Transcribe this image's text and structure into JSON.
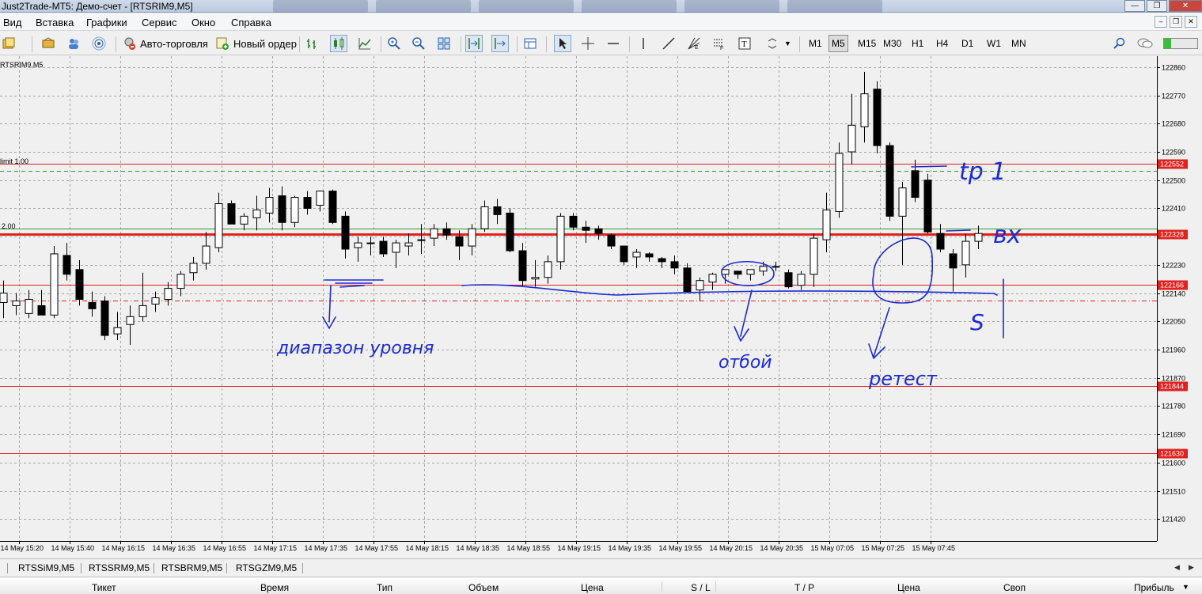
{
  "window": {
    "title": "Just2Trade-MT5: Демо-счет - [RTSRIM9,M5]"
  },
  "menu": [
    "Вид",
    "Вставка",
    "Графики",
    "Сервис",
    "Окно",
    "Справка"
  ],
  "toolbar": {
    "algo_trading_label": "Авто-торговля",
    "new_order_label": "Новый ордер",
    "timeframes": [
      "M1",
      "M5",
      "M15",
      "M30",
      "H1",
      "H4",
      "D1",
      "W1",
      "MN"
    ],
    "active_timeframe": "M5"
  },
  "chart": {
    "symbol_label": "RTSRIM9,M5",
    "limit_label": "limit 1.00",
    "position_label": "2.00",
    "up_color": "#ffffff",
    "down_color": "#000000",
    "grid_color": "#a8a8a8",
    "level_color": "#e0211e",
    "annotation_color": "#1c2bd6",
    "handwriting": {
      "tp": "tp 1",
      "entry": "вх",
      "stop": "S",
      "range": "диапазон уровня",
      "bounce": "отбой",
      "retest": "ретест"
    }
  },
  "chart_data": {
    "type": "candlestick",
    "symbol": "RTSRIM9",
    "timeframe": "M5",
    "y_ticks": [
      122860,
      122770,
      122680,
      122590,
      122500,
      122410,
      122320,
      122230,
      122140,
      122050,
      121960,
      121870,
      121780,
      121690,
      121600,
      121510,
      121420
    ],
    "ylim": [
      121350,
      122895
    ],
    "x_ticks": [
      "14 May 15:20",
      "14 May 15:40",
      "14 May 16:15",
      "14 May 16:35",
      "14 May 16:55",
      "14 May 17:15",
      "14 May 17:35",
      "14 May 17:55",
      "14 May 18:15",
      "14 May 18:35",
      "14 May 18:55",
      "14 May 19:15",
      "14 May 19:35",
      "14 May 19:55",
      "14 May 20:15",
      "14 May 20:35",
      "15 May 07:05",
      "15 May 07:25",
      "15 May 07:45"
    ],
    "price_levels": [
      {
        "label": "122552",
        "price": 122552,
        "style": "solid",
        "color": "#e0211e"
      },
      {
        "label": "122328",
        "price": 122328,
        "style": "solid-thick",
        "color": "#e0211e"
      },
      {
        "label": "122166",
        "price": 122166,
        "style": "solid",
        "color": "#e0211e"
      },
      {
        "label": "121844",
        "price": 121844,
        "style": "solid",
        "color": "#e0211e"
      },
      {
        "label": "121630",
        "price": 121630,
        "style": "solid",
        "color": "#e0211e"
      },
      {
        "label": "",
        "price": 122530,
        "style": "dashed",
        "color": "#2e9a2e"
      },
      {
        "label": "",
        "price": 122345,
        "style": "solid",
        "color": "#2e9a2e"
      },
      {
        "label": "",
        "price": 122115,
        "style": "dash-dot",
        "color": "#e0211e"
      }
    ],
    "candles": [
      {
        "o": 122110,
        "h": 122180,
        "l": 122060,
        "c": 122140
      },
      {
        "o": 122100,
        "h": 122140,
        "l": 122070,
        "c": 122115
      },
      {
        "o": 122075,
        "h": 122150,
        "l": 122060,
        "c": 122120
      },
      {
        "o": 122100,
        "h": 122150,
        "l": 122075,
        "c": 122070
      },
      {
        "o": 122070,
        "h": 122290,
        "l": 122060,
        "c": 122265
      },
      {
        "o": 122260,
        "h": 122300,
        "l": 122180,
        "c": 122200
      },
      {
        "o": 122215,
        "h": 122245,
        "l": 122100,
        "c": 122120
      },
      {
        "o": 122110,
        "h": 122145,
        "l": 122065,
        "c": 122090
      },
      {
        "o": 122115,
        "h": 122130,
        "l": 121990,
        "c": 122005
      },
      {
        "o": 122010,
        "h": 122080,
        "l": 121990,
        "c": 122030
      },
      {
        "o": 122040,
        "h": 122100,
        "l": 121975,
        "c": 122065
      },
      {
        "o": 122065,
        "h": 122205,
        "l": 122050,
        "c": 122100
      },
      {
        "o": 122105,
        "h": 122145,
        "l": 122080,
        "c": 122125
      },
      {
        "o": 122120,
        "h": 122175,
        "l": 122100,
        "c": 122155
      },
      {
        "o": 122155,
        "h": 122210,
        "l": 122130,
        "c": 122200
      },
      {
        "o": 122205,
        "h": 122255,
        "l": 122180,
        "c": 122235
      },
      {
        "o": 122235,
        "h": 122335,
        "l": 122215,
        "c": 122290
      },
      {
        "o": 122285,
        "h": 122460,
        "l": 122270,
        "c": 122425
      },
      {
        "o": 122425,
        "h": 122435,
        "l": 122360,
        "c": 122360
      },
      {
        "o": 122360,
        "h": 122395,
        "l": 122340,
        "c": 122385
      },
      {
        "o": 122380,
        "h": 122450,
        "l": 122340,
        "c": 122405
      },
      {
        "o": 122395,
        "h": 122475,
        "l": 122365,
        "c": 122445
      },
      {
        "o": 122450,
        "h": 122480,
        "l": 122340,
        "c": 122365
      },
      {
        "o": 122365,
        "h": 122450,
        "l": 122350,
        "c": 122445
      },
      {
        "o": 122445,
        "h": 122465,
        "l": 122390,
        "c": 122410
      },
      {
        "o": 122420,
        "h": 122460,
        "l": 122400,
        "c": 122465
      },
      {
        "o": 122465,
        "h": 122470,
        "l": 122360,
        "c": 122365
      },
      {
        "o": 122385,
        "h": 122400,
        "l": 122250,
        "c": 122280
      },
      {
        "o": 122285,
        "h": 122320,
        "l": 122240,
        "c": 122300
      },
      {
        "o": 122300,
        "h": 122320,
        "l": 122260,
        "c": 122300
      },
      {
        "o": 122305,
        "h": 122320,
        "l": 122255,
        "c": 122265
      },
      {
        "o": 122270,
        "h": 122310,
        "l": 122220,
        "c": 122300
      },
      {
        "o": 122290,
        "h": 122330,
        "l": 122260,
        "c": 122300
      },
      {
        "o": 122310,
        "h": 122360,
        "l": 122265,
        "c": 122310
      },
      {
        "o": 122315,
        "h": 122360,
        "l": 122290,
        "c": 122345
      },
      {
        "o": 122345,
        "h": 122365,
        "l": 122310,
        "c": 122325
      },
      {
        "o": 122320,
        "h": 122340,
        "l": 122245,
        "c": 122290
      },
      {
        "o": 122290,
        "h": 122360,
        "l": 122260,
        "c": 122345
      },
      {
        "o": 122345,
        "h": 122435,
        "l": 122335,
        "c": 122415
      },
      {
        "o": 122415,
        "h": 122440,
        "l": 122360,
        "c": 122390
      },
      {
        "o": 122395,
        "h": 122410,
        "l": 122270,
        "c": 122275
      },
      {
        "o": 122275,
        "h": 122300,
        "l": 122160,
        "c": 122180
      },
      {
        "o": 122185,
        "h": 122245,
        "l": 122160,
        "c": 122190
      },
      {
        "o": 122190,
        "h": 122260,
        "l": 122170,
        "c": 122240
      },
      {
        "o": 122240,
        "h": 122395,
        "l": 122215,
        "c": 122385
      },
      {
        "o": 122385,
        "h": 122395,
        "l": 122340,
        "c": 122350
      },
      {
        "o": 122350,
        "h": 122370,
        "l": 122300,
        "c": 122340
      },
      {
        "o": 122345,
        "h": 122355,
        "l": 122310,
        "c": 122330
      },
      {
        "o": 122325,
        "h": 122330,
        "l": 122280,
        "c": 122290
      },
      {
        "o": 122290,
        "h": 122290,
        "l": 122230,
        "c": 122240
      },
      {
        "o": 122255,
        "h": 122280,
        "l": 122220,
        "c": 122270
      },
      {
        "o": 122265,
        "h": 122270,
        "l": 122240,
        "c": 122255
      },
      {
        "o": 122250,
        "h": 122255,
        "l": 122220,
        "c": 122240
      },
      {
        "o": 122240,
        "h": 122260,
        "l": 122200,
        "c": 122220
      },
      {
        "o": 122220,
        "h": 122235,
        "l": 122140,
        "c": 122145
      },
      {
        "o": 122150,
        "h": 122190,
        "l": 122115,
        "c": 122180
      },
      {
        "o": 122175,
        "h": 122205,
        "l": 122150,
        "c": 122200
      },
      {
        "o": 122200,
        "h": 122215,
        "l": 122170,
        "c": 122215
      },
      {
        "o": 122210,
        "h": 122210,
        "l": 122185,
        "c": 122200
      },
      {
        "o": 122200,
        "h": 122215,
        "l": 122180,
        "c": 122215
      },
      {
        "o": 122210,
        "h": 122240,
        "l": 122195,
        "c": 122225
      },
      {
        "o": 122225,
        "h": 122240,
        "l": 122210,
        "c": 122225
      },
      {
        "o": 122205,
        "h": 122215,
        "l": 122155,
        "c": 122160
      },
      {
        "o": 122165,
        "h": 122210,
        "l": 122150,
        "c": 122200
      },
      {
        "o": 122200,
        "h": 122330,
        "l": 122160,
        "c": 122315
      },
      {
        "o": 122310,
        "h": 122460,
        "l": 122270,
        "c": 122405
      },
      {
        "o": 122400,
        "h": 122620,
        "l": 122380,
        "c": 122585
      },
      {
        "o": 122590,
        "h": 122775,
        "l": 122550,
        "c": 122675
      },
      {
        "o": 122670,
        "h": 122845,
        "l": 122620,
        "c": 122775
      },
      {
        "o": 122790,
        "h": 122815,
        "l": 122585,
        "c": 122610
      },
      {
        "o": 122610,
        "h": 122620,
        "l": 122370,
        "c": 122385
      },
      {
        "o": 122385,
        "h": 122495,
        "l": 122230,
        "c": 122475
      },
      {
        "o": 122530,
        "h": 122565,
        "l": 122430,
        "c": 122445
      },
      {
        "o": 122500,
        "h": 122520,
        "l": 122330,
        "c": 122335
      },
      {
        "o": 122330,
        "h": 122360,
        "l": 122270,
        "c": 122280
      },
      {
        "o": 122265,
        "h": 122280,
        "l": 122145,
        "c": 122220
      },
      {
        "o": 122230,
        "h": 122330,
        "l": 122190,
        "c": 122305
      },
      {
        "o": 122305,
        "h": 122355,
        "l": 122280,
        "c": 122330
      }
    ]
  },
  "symbol_tabs": [
    "RTSSiM9,M5",
    "RTSSRM9,M5",
    "RTSBRM9,M5",
    "RTSGZM9,M5"
  ],
  "terminal_columns": [
    "Тикет",
    "Время",
    "Тип",
    "Объем",
    "Цена",
    "S / L",
    "T / P",
    "Цена",
    "Своп",
    "Прибыль"
  ]
}
